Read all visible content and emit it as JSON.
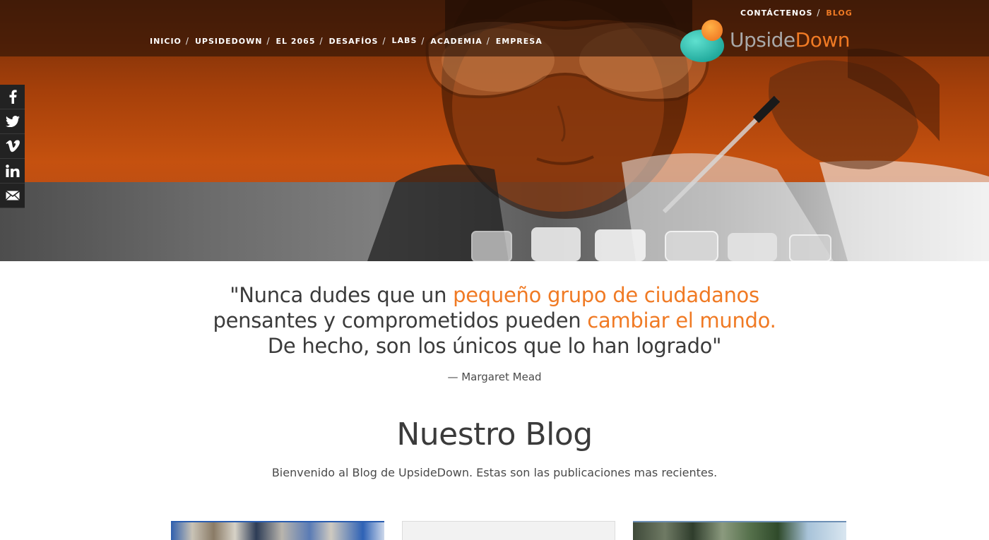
{
  "colors": {
    "accent": "#f07a24",
    "text": "#3b3b3b",
    "topbar": "#2a1206",
    "social_bg": "#222222"
  },
  "top_links": {
    "contact": "CONTÁCTENOS",
    "blog": "BLOG",
    "separator": "/"
  },
  "main_nav": {
    "separator": "/",
    "items": [
      {
        "label": "INICIO"
      },
      {
        "label": "UPSIDEDOWN"
      },
      {
        "label": "EL 2065"
      },
      {
        "label": "DESAFÍOS"
      },
      {
        "label": "LABS"
      },
      {
        "label": "ACADEMIA"
      },
      {
        "label": "EMPRESA"
      }
    ]
  },
  "logo": {
    "word1": "Upside",
    "word2": "Down"
  },
  "social": [
    {
      "icon": "facebook-icon"
    },
    {
      "icon": "twitter-icon"
    },
    {
      "icon": "vimeo-icon"
    },
    {
      "icon": "linkedin-icon"
    },
    {
      "icon": "email-icon"
    }
  ],
  "quote": {
    "line1_a": "\"Nunca dudes que un ",
    "line1_b": "pequeño grupo de ciudadanos",
    "line2_a": "pensantes y comprometidos pueden ",
    "line2_b": "cambiar el mundo.",
    "line3": "De hecho, son los únicos que lo han logrado\"",
    "author": "— Margaret Mead"
  },
  "blog": {
    "title": "Nuestro Blog",
    "subtitle": "Bienvenido al Blog de UpsideDown.  Estas son las publicaciones mas recientes."
  }
}
